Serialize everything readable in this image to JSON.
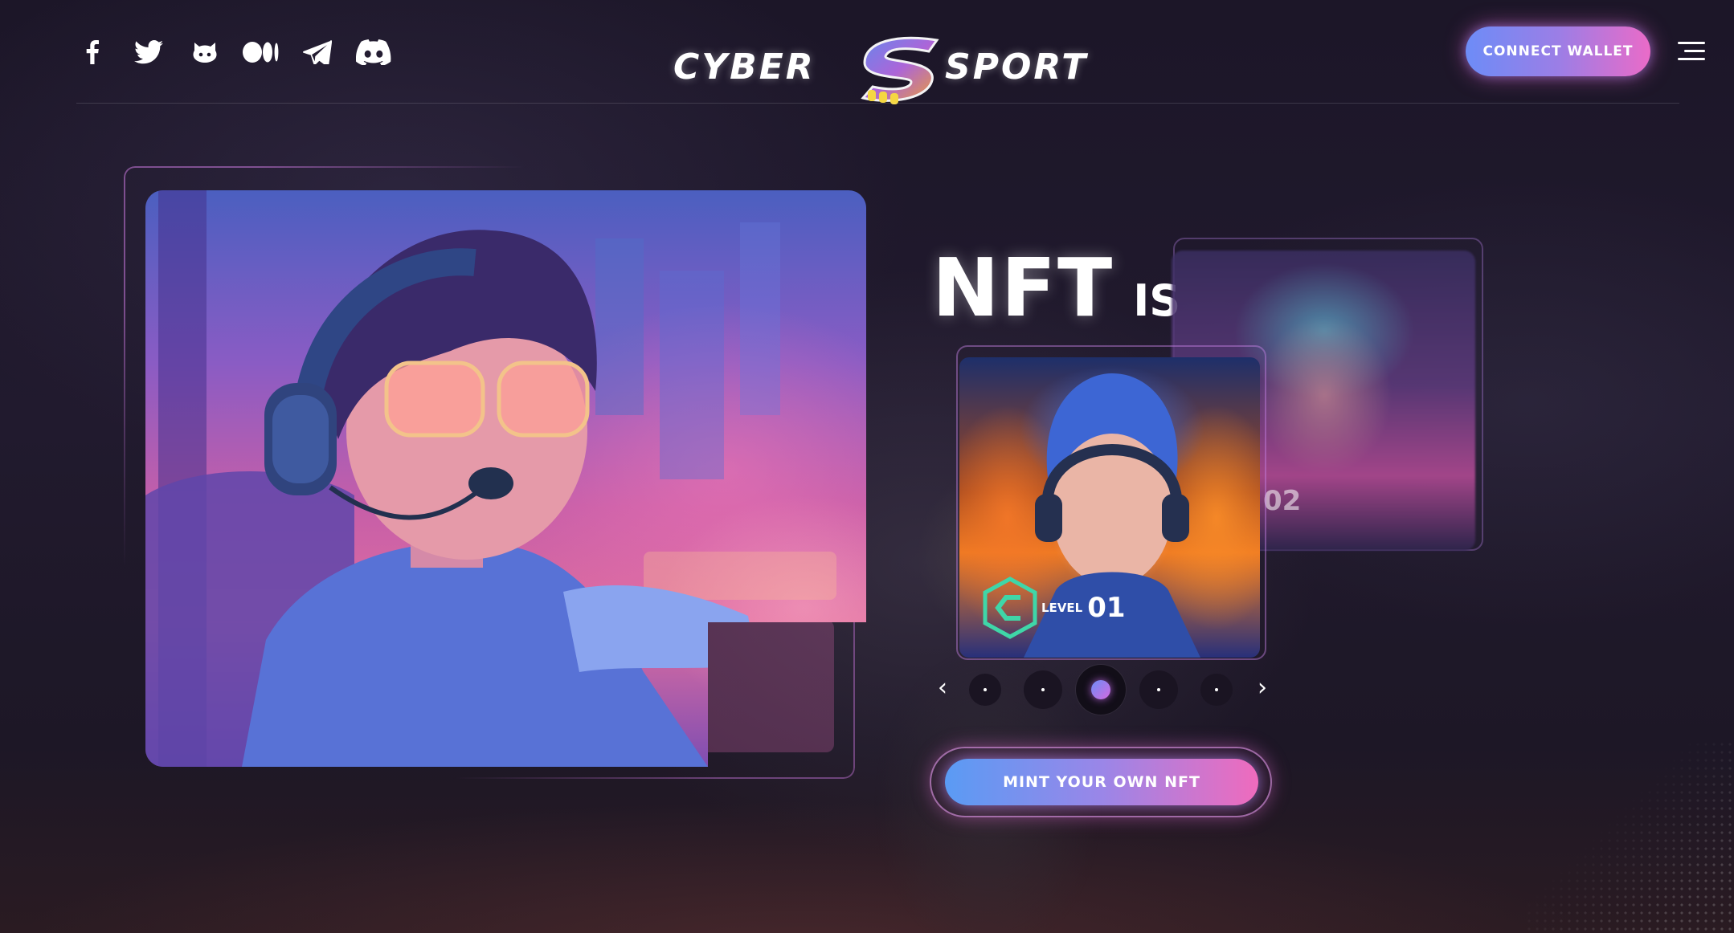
{
  "brand": {
    "logo_left": "CYBER",
    "logo_right": "SPORT",
    "accent_gradient": [
      "#6d8cf7",
      "#9b7ee6",
      "#ea6bc8"
    ]
  },
  "header": {
    "socials": [
      {
        "name": "facebook-icon",
        "label": "Facebook"
      },
      {
        "name": "twitter-icon",
        "label": "Twitter"
      },
      {
        "name": "github-icon",
        "label": "GitHub"
      },
      {
        "name": "medium-icon",
        "label": "Medium"
      },
      {
        "name": "telegram-icon",
        "label": "Telegram"
      },
      {
        "name": "discord-icon",
        "label": "Discord"
      }
    ],
    "connect_wallet_label": "CONNECT WALLET",
    "menu_icon": "hamburger-menu-icon"
  },
  "hero": {
    "title_big": "NFT",
    "title_small": "IS",
    "cards": [
      {
        "level_word": "LEVEL",
        "level_num": "01"
      },
      {
        "number": "02"
      }
    ],
    "carousel": {
      "dot_count": 5,
      "active_index": 2,
      "prev_icon": "chevron-left-icon",
      "next_icon": "chevron-right-icon",
      "prev_glyph": "‹",
      "next_glyph": "›"
    },
    "mint_label": "MINT YOUR OWN NFT"
  }
}
